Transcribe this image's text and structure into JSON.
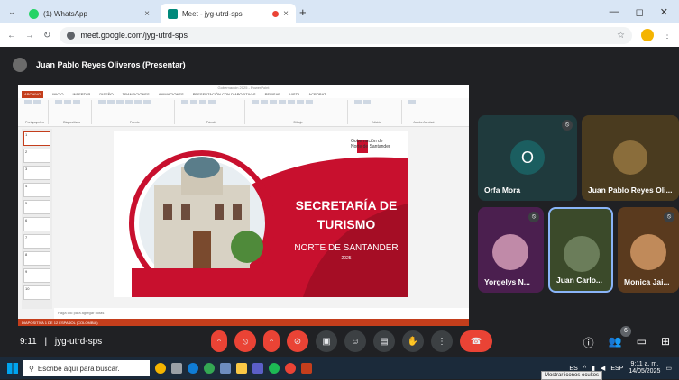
{
  "browser": {
    "tabs": [
      {
        "label": "(1) WhatsApp",
        "close": "×",
        "favicon_color": "#25d366"
      },
      {
        "label": "Meet - jyg-utrd-sps",
        "close": "×",
        "favicon_color": "#00897b"
      }
    ],
    "new_tab": "+",
    "url": "meet.google.com/jyg-utrd-sps"
  },
  "meet": {
    "presenter_label": "Juan Pablo Reyes Oliveros (Presentar)",
    "time": "9:11",
    "separator": "|",
    "meeting_code": "jyg-utrd-sps",
    "participants_count": "6",
    "participants": [
      {
        "name": "Orfa Mora",
        "initial": "O"
      },
      {
        "name": "Juan Pablo Reyes Oli..."
      },
      {
        "name": "Yorgelys N..."
      },
      {
        "name": "Juan Carlo..."
      },
      {
        "name": "Monica Jai..."
      }
    ]
  },
  "presentation": {
    "window_title": "Gobernación 2025 - PowerPoint",
    "ribbon_tabs": [
      "ARCHIVO",
      "INICIO",
      "INSERTAR",
      "DISEÑO",
      "TRANSICIONES",
      "ANIMACIONES",
      "PRESENTACIÓN CON DIAPOSITIVAS",
      "REVISAR",
      "VISTA",
      "ACROBAT"
    ],
    "ribbon_groups": [
      "Portapapeles",
      "Diapositivas",
      "Fuente",
      "Párrafo",
      "Dibujo",
      "Edición",
      "Adobe Acrobat"
    ],
    "slide": {
      "logo_text": "Gobernación de Norte de Santander",
      "title_line1": "SECRETARÍA DE",
      "title_line2": "TURISMO",
      "subtitle": "NORTE DE SANTANDER",
      "year": "2025"
    },
    "notes_placeholder": "Haga clic para agregar notas",
    "status_text": "DIAPOSITIVA 1 DE 12   ESPAÑOL (COLOMBIA)",
    "thumbnails": [
      "1",
      "2",
      "3",
      "4",
      "5",
      "6",
      "7",
      "8",
      "9",
      "10"
    ]
  },
  "taskbar": {
    "search_placeholder": "Escribe aquí para buscar.",
    "language": "ES",
    "keyboard": "ESP",
    "clock_time": "9:11 a. m.",
    "clock_date": "14/05/2025",
    "tooltip": "Mostrar iconos ocultos"
  },
  "colors": {
    "accent_red": "#ea4335",
    "slide_red": "#c8102e",
    "meet_bg": "#202124",
    "ppt_orange": "#c43e1c"
  }
}
